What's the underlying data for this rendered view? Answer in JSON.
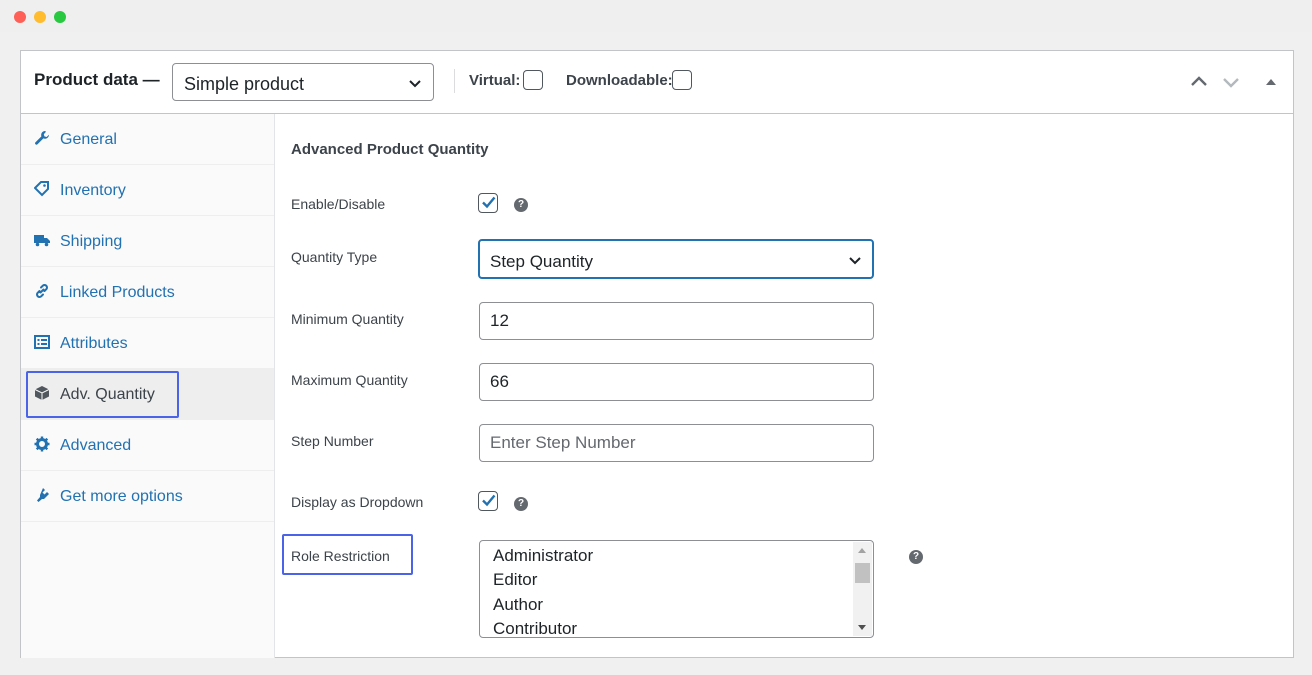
{
  "header": {
    "title": "Product data —",
    "product_type": "Simple product",
    "virtual_label": "Virtual:",
    "downloadable_label": "Downloadable:"
  },
  "sidebar": {
    "items": [
      {
        "label": "General",
        "icon": "wrench-icon"
      },
      {
        "label": "Inventory",
        "icon": "tag-icon"
      },
      {
        "label": "Shipping",
        "icon": "truck-icon"
      },
      {
        "label": "Linked Products",
        "icon": "link-icon"
      },
      {
        "label": "Attributes",
        "icon": "list-icon"
      },
      {
        "label": "Adv. Quantity",
        "icon": "box-icon",
        "active": true
      },
      {
        "label": "Advanced",
        "icon": "gear-icon"
      },
      {
        "label": "Get more options",
        "icon": "plugin-icon"
      }
    ]
  },
  "main": {
    "section_title": "Advanced Product Quantity",
    "enable_label": "Enable/Disable",
    "quantity_type_label": "Quantity Type",
    "quantity_type_value": "Step Quantity",
    "min_label": "Minimum Quantity",
    "min_value": "12",
    "max_label": "Maximum Quantity",
    "max_value": "66",
    "step_label": "Step Number",
    "step_placeholder": "Enter Step Number",
    "dropdown_label": "Display as Dropdown",
    "role_label": "Role Restriction",
    "roles": [
      "Administrator",
      "Editor",
      "Author",
      "Contributor"
    ],
    "help_glyph": "?"
  },
  "colors": {
    "link": "#2271b1",
    "highlight": "#4b63e6"
  }
}
